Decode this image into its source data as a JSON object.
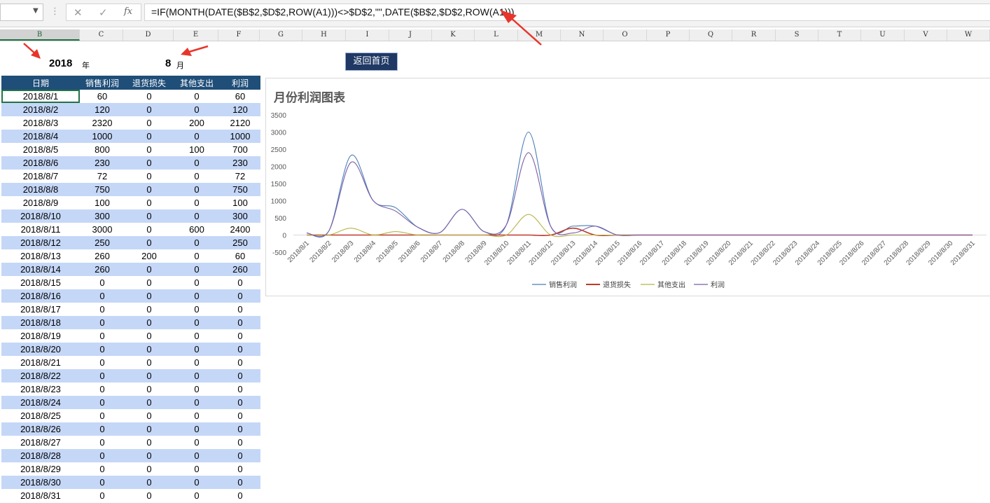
{
  "formula_bar": {
    "formula": "=IF(MONTH(DATE($B$2,$D$2,ROW(A1)))<>$D$2,\"\",DATE($B$2,$D$2,ROW(A1)))",
    "dots": "⋮",
    "icons": [
      "cancel-icon",
      "enter-icon",
      "insert-function-icon"
    ]
  },
  "columns": [
    "B",
    "C",
    "D",
    "E",
    "F",
    "G",
    "H",
    "I",
    "J",
    "K",
    "L",
    "M",
    "N",
    "O",
    "P",
    "Q",
    "R",
    "S",
    "T",
    "U",
    "V",
    "W"
  ],
  "selected_column": "B",
  "header": {
    "year": "2018",
    "year_unit": "年",
    "month": "8",
    "month_unit": "月",
    "return_button": "返回首页"
  },
  "table": {
    "headers": [
      "日期",
      "销售利润",
      "退货损失",
      "其他支出",
      "利润"
    ],
    "rows": [
      [
        "2018/8/1",
        "60",
        "0",
        "0",
        "60"
      ],
      [
        "2018/8/2",
        "120",
        "0",
        "0",
        "120"
      ],
      [
        "2018/8/3",
        "2320",
        "0",
        "200",
        "2120"
      ],
      [
        "2018/8/4",
        "1000",
        "0",
        "0",
        "1000"
      ],
      [
        "2018/8/5",
        "800",
        "0",
        "100",
        "700"
      ],
      [
        "2018/8/6",
        "230",
        "0",
        "0",
        "230"
      ],
      [
        "2018/8/7",
        "72",
        "0",
        "0",
        "72"
      ],
      [
        "2018/8/8",
        "750",
        "0",
        "0",
        "750"
      ],
      [
        "2018/8/9",
        "100",
        "0",
        "0",
        "100"
      ],
      [
        "2018/8/10",
        "300",
        "0",
        "0",
        "300"
      ],
      [
        "2018/8/11",
        "3000",
        "0",
        "600",
        "2400"
      ],
      [
        "2018/8/12",
        "250",
        "0",
        "0",
        "250"
      ],
      [
        "2018/8/13",
        "260",
        "200",
        "0",
        "60"
      ],
      [
        "2018/8/14",
        "260",
        "0",
        "0",
        "260"
      ],
      [
        "2018/8/15",
        "0",
        "0",
        "0",
        "0"
      ],
      [
        "2018/8/16",
        "0",
        "0",
        "0",
        "0"
      ],
      [
        "2018/8/17",
        "0",
        "0",
        "0",
        "0"
      ],
      [
        "2018/8/18",
        "0",
        "0",
        "0",
        "0"
      ],
      [
        "2018/8/19",
        "0",
        "0",
        "0",
        "0"
      ],
      [
        "2018/8/20",
        "0",
        "0",
        "0",
        "0"
      ],
      [
        "2018/8/21",
        "0",
        "0",
        "0",
        "0"
      ],
      [
        "2018/8/22",
        "0",
        "0",
        "0",
        "0"
      ],
      [
        "2018/8/23",
        "0",
        "0",
        "0",
        "0"
      ],
      [
        "2018/8/24",
        "0",
        "0",
        "0",
        "0"
      ],
      [
        "2018/8/25",
        "0",
        "0",
        "0",
        "0"
      ],
      [
        "2018/8/26",
        "0",
        "0",
        "0",
        "0"
      ],
      [
        "2018/8/27",
        "0",
        "0",
        "0",
        "0"
      ],
      [
        "2018/8/28",
        "0",
        "0",
        "0",
        "0"
      ],
      [
        "2018/8/29",
        "0",
        "0",
        "0",
        "0"
      ],
      [
        "2018/8/30",
        "0",
        "0",
        "0",
        "0"
      ],
      [
        "2018/8/31",
        "0",
        "0",
        "0",
        "0"
      ]
    ]
  },
  "colors": {
    "header_bg": "#1f4e79",
    "band": "#c5d7f7",
    "button_bg": "#1f3864",
    "selection": "#217346",
    "arrow": "#e8352b"
  },
  "chart_data": {
    "type": "line",
    "title": "月份利润图表",
    "smooth": true,
    "categories": [
      "2018/8/1",
      "2018/8/2",
      "2018/8/3",
      "2018/8/4",
      "2018/8/5",
      "2018/8/6",
      "2018/8/7",
      "2018/8/8",
      "2018/8/9",
      "2018/8/10",
      "2018/8/11",
      "2018/8/12",
      "2018/8/13",
      "2018/8/14",
      "2018/8/15",
      "2018/8/16",
      "2018/8/17",
      "2018/8/18",
      "2018/8/19",
      "2018/8/20",
      "2018/8/21",
      "2018/8/22",
      "2018/8/23",
      "2018/8/24",
      "2018/8/25",
      "2018/8/26",
      "2018/8/27",
      "2018/8/28",
      "2018/8/29",
      "2018/8/30",
      "2018/8/31"
    ],
    "series": [
      {
        "name": "销售利润",
        "color": "#4a7ebb",
        "values": [
          60,
          120,
          2320,
          1000,
          800,
          230,
          72,
          750,
          100,
          300,
          3000,
          250,
          260,
          260,
          0,
          0,
          0,
          0,
          0,
          0,
          0,
          0,
          0,
          0,
          0,
          0,
          0,
          0,
          0,
          0,
          0
        ]
      },
      {
        "name": "退货损失",
        "color": "#c0392b",
        "values": [
          0,
          0,
          0,
          0,
          0,
          0,
          0,
          0,
          0,
          0,
          0,
          0,
          200,
          0,
          0,
          0,
          0,
          0,
          0,
          0,
          0,
          0,
          0,
          0,
          0,
          0,
          0,
          0,
          0,
          0,
          0
        ]
      },
      {
        "name": "其他支出",
        "color": "#b5b545",
        "values": [
          0,
          0,
          200,
          0,
          100,
          0,
          0,
          0,
          0,
          0,
          600,
          0,
          0,
          0,
          0,
          0,
          0,
          0,
          0,
          0,
          0,
          0,
          0,
          0,
          0,
          0,
          0,
          0,
          0,
          0,
          0
        ]
      },
      {
        "name": "利润",
        "color": "#7b5ea7",
        "values": [
          60,
          120,
          2120,
          1000,
          700,
          230,
          72,
          750,
          100,
          300,
          2400,
          250,
          60,
          260,
          0,
          0,
          0,
          0,
          0,
          0,
          0,
          0,
          0,
          0,
          0,
          0,
          0,
          0,
          0,
          0,
          0
        ]
      }
    ],
    "ylim": [
      -500,
      3500
    ],
    "yticks": [
      -500,
      0,
      500,
      1000,
      1500,
      2000,
      2500,
      3000,
      3500
    ],
    "legend": "bottom",
    "grid": false
  }
}
